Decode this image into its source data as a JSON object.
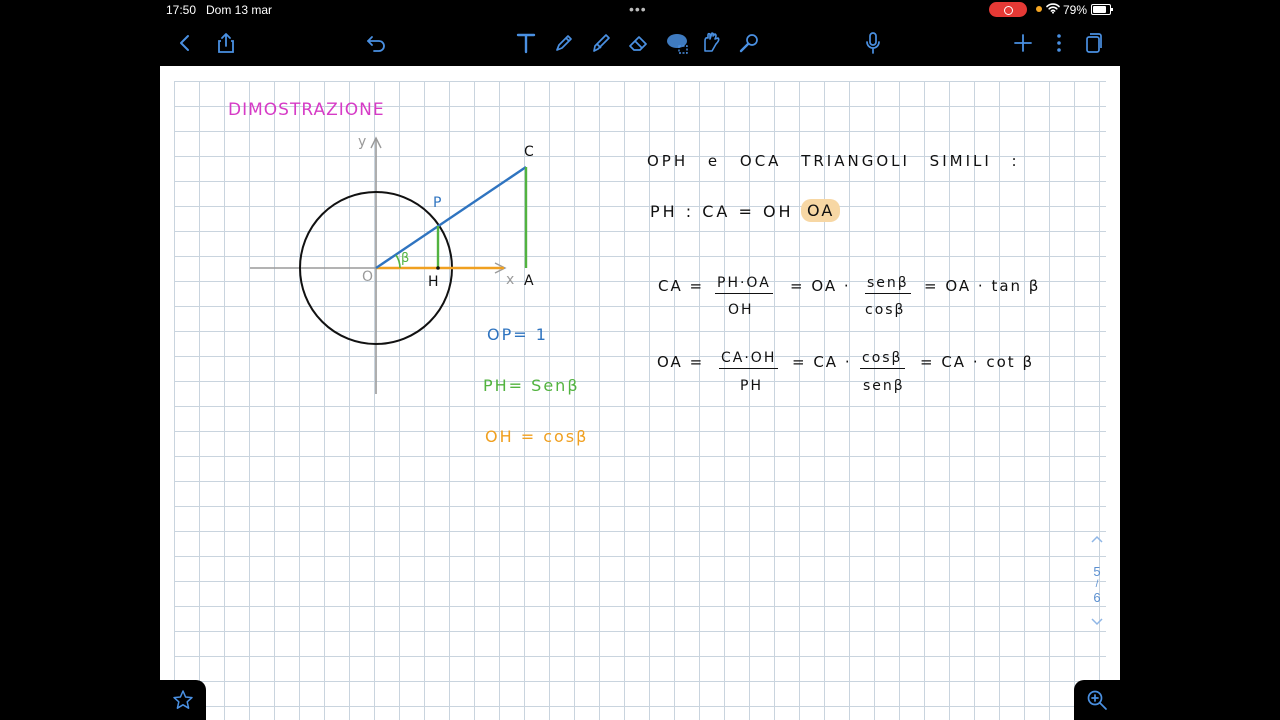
{
  "status": {
    "time": "17:50",
    "date": "Dom 13 mar",
    "battery": "79%"
  },
  "toolbar": {
    "icons": [
      "back-icon",
      "share-icon",
      "undo-icon",
      "text-tool-icon",
      "pen-icon",
      "highlighter-icon",
      "eraser-icon",
      "lasso-icon",
      "shapes-icon",
      "laser-pointer-icon",
      "microphone-icon",
      "add-icon",
      "more-icon",
      "pages-icon"
    ]
  },
  "note": {
    "title": "DIMOSTRAZIONE",
    "diagram": {
      "axis_y": "y",
      "axis_x": "x",
      "origin": "O",
      "point_p": "P",
      "point_h": "H",
      "point_a": "A",
      "point_c": "C",
      "angle": "β"
    },
    "legend": {
      "op": "OP= 1",
      "ph": "PH= Senβ",
      "oh": "OH = cosβ"
    },
    "heading": "OPH e OCA TRIANGOLI SIMILI :",
    "proportion_left": "PH : CA = OH :",
    "proportion_highlight": "OA",
    "eq1": {
      "lhs": "CA =",
      "frac1_num": "PH·OA",
      "frac1_den": "OH",
      "mid": "= OA ·",
      "frac2_num": "senβ",
      "frac2_den": "cosβ",
      "rhs": "= OA · tan β"
    },
    "eq2": {
      "lhs": "OA =",
      "frac1_num": "CA·OH",
      "frac1_den": "PH",
      "mid": "= CA ·",
      "frac2_num": "cosβ",
      "frac2_den": "senβ",
      "rhs": "= CA · cot β"
    }
  },
  "pager": {
    "current": "5",
    "sep": "/",
    "total": "6"
  },
  "colors": {
    "title": "#d63bc6",
    "blue": "#2f74c0",
    "green": "#52b33f",
    "orange": "#f0a020",
    "highlight": "#f7d7a4"
  }
}
